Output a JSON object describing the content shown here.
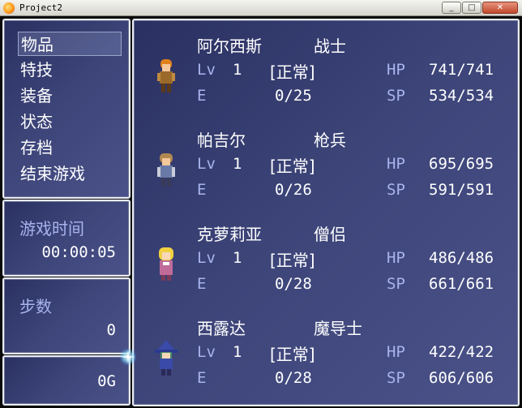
{
  "window": {
    "title": "Project2",
    "close_glyph": "✕",
    "minimize_glyph": "_",
    "maximize_glyph": "□"
  },
  "menu": {
    "items": [
      {
        "label": "物品"
      },
      {
        "label": "特技"
      },
      {
        "label": "装备"
      },
      {
        "label": "状态"
      },
      {
        "label": "存档"
      },
      {
        "label": "结束游戏"
      }
    ],
    "selected_index": 0
  },
  "play_time": {
    "label": "游戏时间",
    "value": "00:00:05"
  },
  "steps": {
    "label": "步数",
    "value": "0"
  },
  "gold": {
    "value": "0G"
  },
  "party": [
    {
      "name": "阿尔西斯",
      "class": "战士",
      "lv_label": "Lv",
      "level": "1",
      "state": "[正常]",
      "hp_label": "HP",
      "hp": "741/741",
      "e_label": "E",
      "exp": "0/25",
      "sp_label": "SP",
      "sp": "534/534",
      "sprite": "warrior-sprite",
      "hair_color": "#e0801c",
      "body_color": "#9a6a2a"
    },
    {
      "name": "帕吉尔",
      "class": "枪兵",
      "lv_label": "Lv",
      "level": "1",
      "state": "[正常]",
      "hp_label": "HP",
      "hp": "695/695",
      "e_label": "E",
      "exp": "0/26",
      "sp_label": "SP",
      "sp": "591/591",
      "sprite": "lancer-sprite",
      "hair_color": "#b08850",
      "body_color": "#6a7aa8"
    },
    {
      "name": "克萝莉亚",
      "class": "僧侣",
      "lv_label": "Lv",
      "level": "1",
      "state": "[正常]",
      "hp_label": "HP",
      "hp": "486/486",
      "e_label": "E",
      "exp": "0/28",
      "sp_label": "SP",
      "sp": "661/661",
      "sprite": "cleric-sprite",
      "hair_color": "#f0d040",
      "body_color": "#c06a9a"
    },
    {
      "name": "西露达",
      "class": "魔导士",
      "lv_label": "Lv",
      "level": "1",
      "state": "[正常]",
      "hp_label": "HP",
      "hp": "422/422",
      "e_label": "E",
      "exp": "0/28",
      "sp_label": "SP",
      "sp": "606/606",
      "sprite": "mage-sprite",
      "hair_color": "#4a8a6a",
      "body_color": "#3a4aa8"
    }
  ]
}
